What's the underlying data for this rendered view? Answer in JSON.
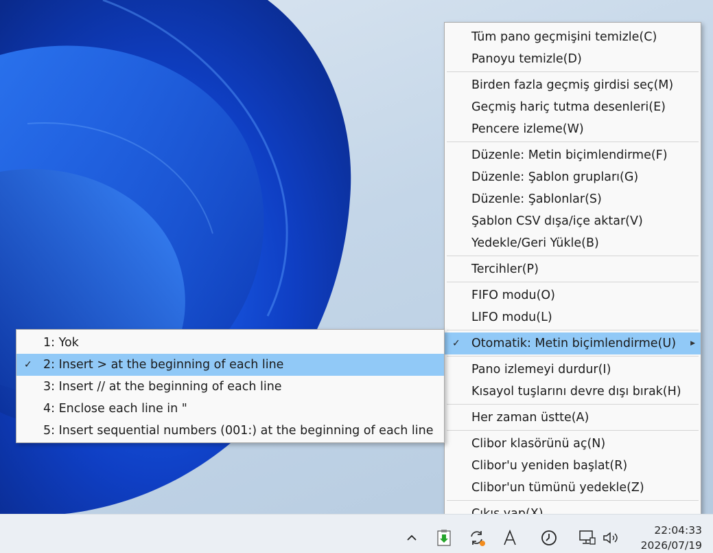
{
  "main_menu": {
    "groups": [
      [
        "Tüm pano geçmişini temizle(C)",
        "Panoyu temizle(D)"
      ],
      [
        "Birden fazla geçmiş girdisi seç(M)",
        "Geçmiş hariç tutma desenleri(E)",
        "Pencere izleme(W)"
      ],
      [
        "Düzenle: Metin biçimlendirme(F)",
        "Düzenle: Şablon grupları(G)",
        "Düzenle: Şablonlar(S)",
        "Şablon CSV dışa/içe aktar(V)",
        "Yedekle/Geri Yükle(B)"
      ],
      [
        "Tercihler(P)"
      ],
      [
        "FIFO modu(O)",
        "LIFO modu(L)"
      ],
      [
        "Otomatik: Metin biçimlendirme(U)"
      ],
      [
        "Pano izlemeyi durdur(I)",
        "Kısayol tuşlarını devre dışı bırak(H)"
      ],
      [
        "Her zaman üstte(A)"
      ],
      [
        "Clibor klasörünü aç(N)",
        "Clibor'u yeniden başlat(R)",
        "Clibor'un tümünü yedekle(Z)"
      ],
      [
        "Çıkış yap(X)"
      ]
    ]
  },
  "sub_menu": {
    "items": [
      "1: Yok",
      "2: Insert > at the beginning of each line",
      "3: Insert // at the beginning of each line",
      "4: Enclose each line in \"",
      "5: Insert sequential numbers (001:) at the beginning of each line"
    ]
  },
  "taskbar": {
    "time": "22:04:33",
    "date": "2026/07/19",
    "icons": [
      "chevron-up-icon",
      "clibor-icon",
      "sync-icon",
      "font-icon",
      "clock-icon",
      "network-icon",
      "volume-icon"
    ]
  },
  "colors": {
    "highlight": "#91c9f7",
    "menu_bg": "#f9f9f9"
  }
}
